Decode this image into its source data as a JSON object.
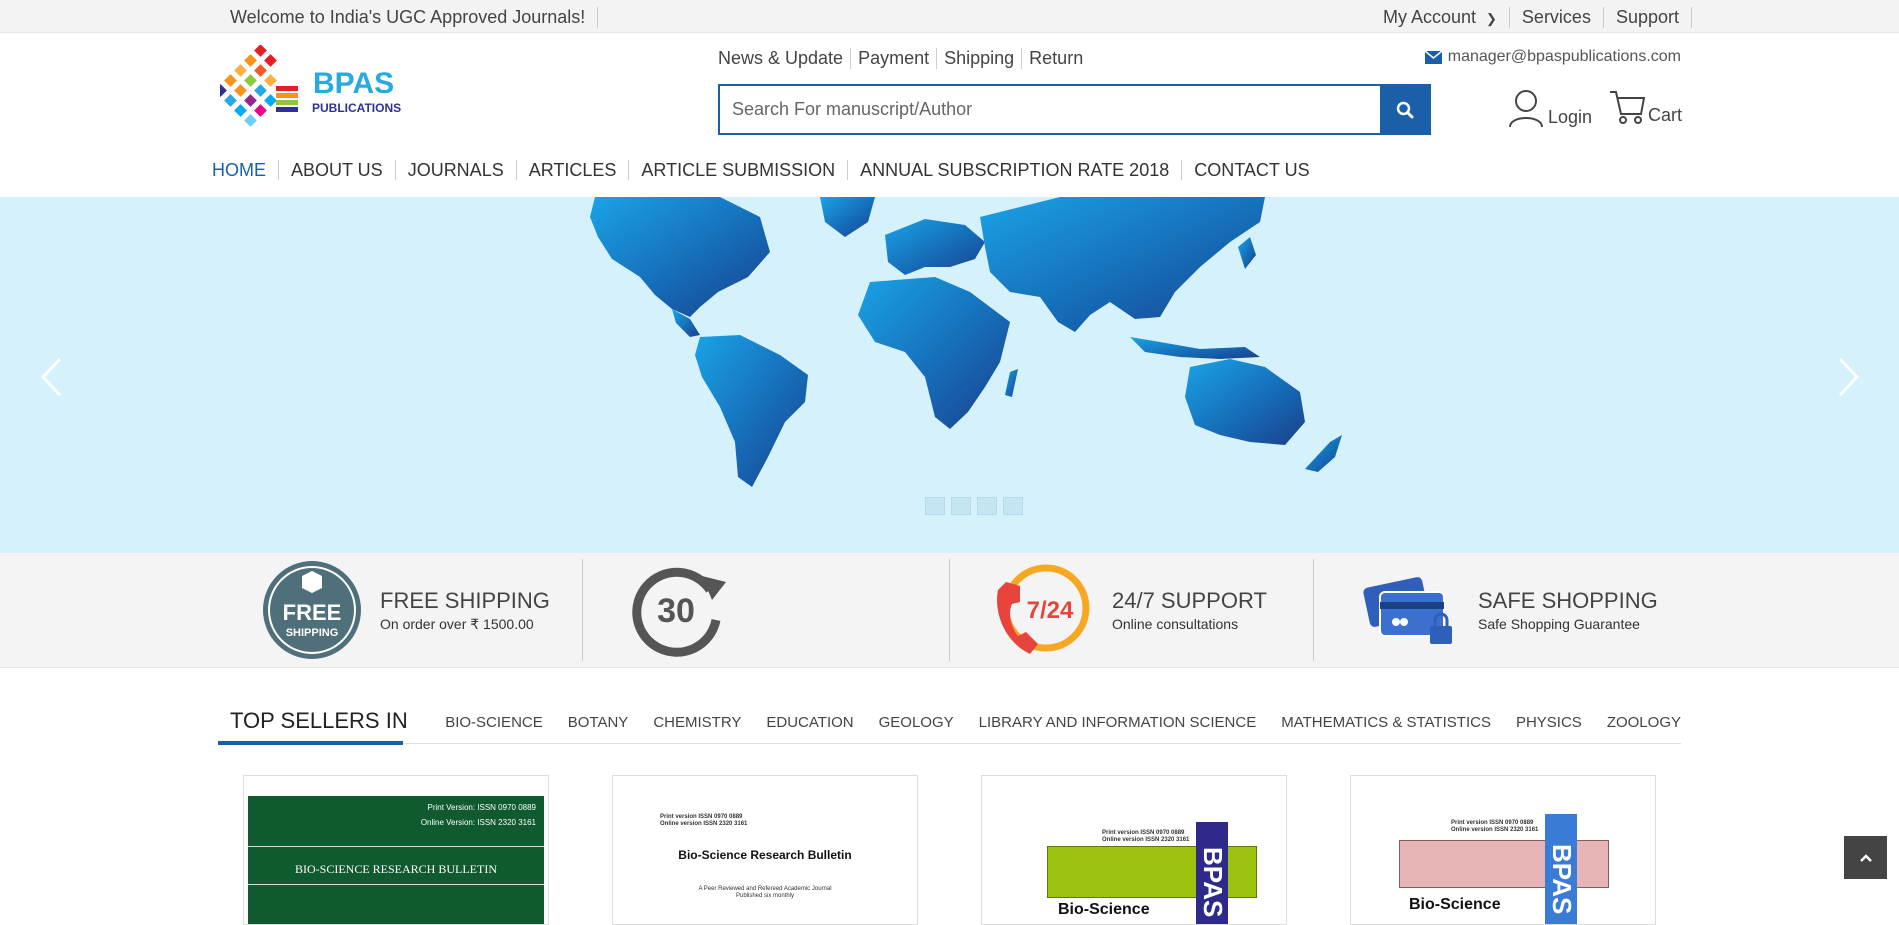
{
  "topbar": {
    "welcome": "Welcome to India's UGC Approved Journals!",
    "my_account": "My Account",
    "services": "Services",
    "support": "Support"
  },
  "header": {
    "logo_text": "BPAS",
    "logo_sub": "PUBLICATIONS",
    "links": [
      "News & Update",
      "Payment",
      "Shipping",
      "Return"
    ],
    "email": "manager@bpaspublications.com",
    "search_placeholder": "Search For manuscript/Author",
    "login": "Login",
    "cart": "Cart"
  },
  "main_nav": [
    "HOME",
    "ABOUT US",
    "JOURNALS",
    "ARTICLES",
    "ARTICLE SUBMISSION",
    "ANNUAL SUBSCRIPTION RATE 2018",
    "CONTACT US"
  ],
  "features": [
    {
      "icon": "free-shipping-icon",
      "badge_line1": "FREE",
      "badge_line2": "SHIPPING",
      "title": "FREE SHIPPING",
      "subtitle": "On order over ₹ 1500.00"
    },
    {
      "icon": "30-days-icon",
      "badge": "30",
      "title": "",
      "subtitle": ""
    },
    {
      "icon": "support-24-7-icon",
      "badge": "7/24",
      "title": "24/7 SUPPORT",
      "subtitle": "Online consultations"
    },
    {
      "icon": "safe-shopping-icon",
      "title": "SAFE SHOPPING",
      "subtitle": "Safe Shopping Guarantee"
    }
  ],
  "top_sellers": {
    "heading": "TOP SELLERS IN",
    "categories": [
      "BIO-SCIENCE",
      "BOTANY",
      "CHEMISTRY",
      "EDUCATION",
      "GEOLOGY",
      "LIBRARY AND INFORMATION SCIENCE",
      "MATHEMATICS & STATISTICS",
      "PHYSICS",
      "ZOOLOGY"
    ]
  },
  "products": [
    {
      "print": "Print Version: ISSN 0970 0889",
      "online": "Online Version: ISSN 2320 3161",
      "title": "BIO-SCIENCE RESEARCH BULLETIN",
      "color": "#0f5a2e"
    },
    {
      "print": "Print version ISSN 0970 0889",
      "online": "Online version ISSN 2320 3161",
      "title": "Bio-Science Research Bulletin",
      "desc1": "A Peer Reviewed and Refereed Academic Journal",
      "desc2": "Published six monthly"
    },
    {
      "print": "Print version ISSN 0970 0889",
      "online": "Online version ISSN 2320 3161",
      "title": "Bio-Science",
      "spine": "BPAS",
      "band_color": "#9ac40f"
    },
    {
      "print": "Print version ISSN 0970 0889",
      "online": "Online version ISSN 2320 3161",
      "title": "Bio-Science",
      "spine": "BPAS",
      "band_color": "#e6b4b4"
    }
  ],
  "colors": {
    "accent": "#1a5fa8",
    "banner": "#d5f1fb"
  }
}
